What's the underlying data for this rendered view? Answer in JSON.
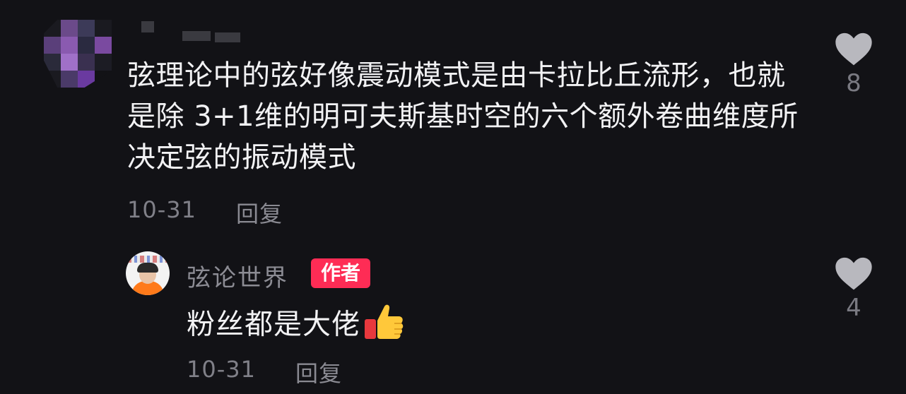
{
  "comment": {
    "text": "弦理论中的弦好像震动模式是由卡拉比丘流形，也就是除 3+1维的明可夫斯基时空的六个额外卷曲维度所决定弦的振动模式",
    "date": "10-31",
    "reply_label": "回复",
    "like_count": "8"
  },
  "reply": {
    "username": "弦论世界",
    "badge": "作者",
    "text": "粉丝都是大佬",
    "emoji": "thumbs-up",
    "date": "10-31",
    "reply_label": "回复",
    "like_count": "4"
  },
  "colors": {
    "background": "#121216",
    "text": "#f2f2f4",
    "muted": "#808088",
    "badge": "#fe2c55",
    "heart": "#b8b8be"
  }
}
